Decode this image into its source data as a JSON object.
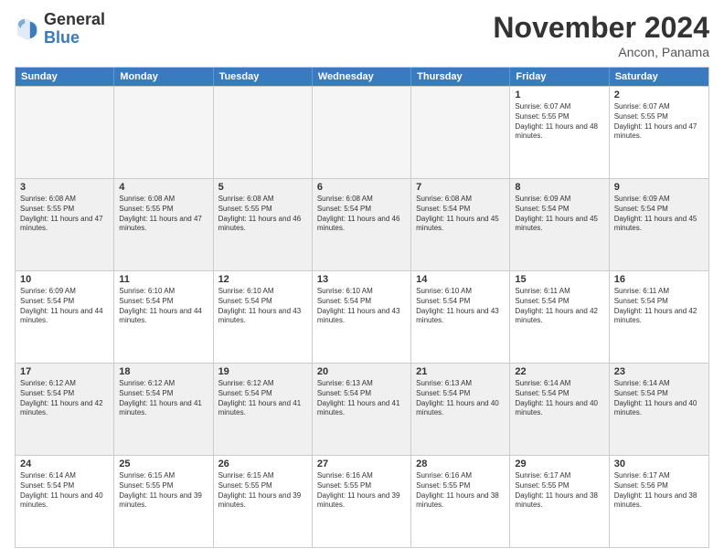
{
  "logo": {
    "general": "General",
    "blue": "Blue"
  },
  "header": {
    "month": "November 2024",
    "location": "Ancon, Panama"
  },
  "weekdays": [
    "Sunday",
    "Monday",
    "Tuesday",
    "Wednesday",
    "Thursday",
    "Friday",
    "Saturday"
  ],
  "rows": [
    [
      {
        "day": "",
        "text": "",
        "empty": true
      },
      {
        "day": "",
        "text": "",
        "empty": true
      },
      {
        "day": "",
        "text": "",
        "empty": true
      },
      {
        "day": "",
        "text": "",
        "empty": true
      },
      {
        "day": "",
        "text": "",
        "empty": true
      },
      {
        "day": "1",
        "text": "Sunrise: 6:07 AM\nSunset: 5:55 PM\nDaylight: 11 hours and 48 minutes.",
        "empty": false
      },
      {
        "day": "2",
        "text": "Sunrise: 6:07 AM\nSunset: 5:55 PM\nDaylight: 11 hours and 47 minutes.",
        "empty": false
      }
    ],
    [
      {
        "day": "3",
        "text": "Sunrise: 6:08 AM\nSunset: 5:55 PM\nDaylight: 11 hours and 47 minutes.",
        "empty": false
      },
      {
        "day": "4",
        "text": "Sunrise: 6:08 AM\nSunset: 5:55 PM\nDaylight: 11 hours and 47 minutes.",
        "empty": false
      },
      {
        "day": "5",
        "text": "Sunrise: 6:08 AM\nSunset: 5:55 PM\nDaylight: 11 hours and 46 minutes.",
        "empty": false
      },
      {
        "day": "6",
        "text": "Sunrise: 6:08 AM\nSunset: 5:54 PM\nDaylight: 11 hours and 46 minutes.",
        "empty": false
      },
      {
        "day": "7",
        "text": "Sunrise: 6:08 AM\nSunset: 5:54 PM\nDaylight: 11 hours and 45 minutes.",
        "empty": false
      },
      {
        "day": "8",
        "text": "Sunrise: 6:09 AM\nSunset: 5:54 PM\nDaylight: 11 hours and 45 minutes.",
        "empty": false
      },
      {
        "day": "9",
        "text": "Sunrise: 6:09 AM\nSunset: 5:54 PM\nDaylight: 11 hours and 45 minutes.",
        "empty": false
      }
    ],
    [
      {
        "day": "10",
        "text": "Sunrise: 6:09 AM\nSunset: 5:54 PM\nDaylight: 11 hours and 44 minutes.",
        "empty": false
      },
      {
        "day": "11",
        "text": "Sunrise: 6:10 AM\nSunset: 5:54 PM\nDaylight: 11 hours and 44 minutes.",
        "empty": false
      },
      {
        "day": "12",
        "text": "Sunrise: 6:10 AM\nSunset: 5:54 PM\nDaylight: 11 hours and 43 minutes.",
        "empty": false
      },
      {
        "day": "13",
        "text": "Sunrise: 6:10 AM\nSunset: 5:54 PM\nDaylight: 11 hours and 43 minutes.",
        "empty": false
      },
      {
        "day": "14",
        "text": "Sunrise: 6:10 AM\nSunset: 5:54 PM\nDaylight: 11 hours and 43 minutes.",
        "empty": false
      },
      {
        "day": "15",
        "text": "Sunrise: 6:11 AM\nSunset: 5:54 PM\nDaylight: 11 hours and 42 minutes.",
        "empty": false
      },
      {
        "day": "16",
        "text": "Sunrise: 6:11 AM\nSunset: 5:54 PM\nDaylight: 11 hours and 42 minutes.",
        "empty": false
      }
    ],
    [
      {
        "day": "17",
        "text": "Sunrise: 6:12 AM\nSunset: 5:54 PM\nDaylight: 11 hours and 42 minutes.",
        "empty": false
      },
      {
        "day": "18",
        "text": "Sunrise: 6:12 AM\nSunset: 5:54 PM\nDaylight: 11 hours and 41 minutes.",
        "empty": false
      },
      {
        "day": "19",
        "text": "Sunrise: 6:12 AM\nSunset: 5:54 PM\nDaylight: 11 hours and 41 minutes.",
        "empty": false
      },
      {
        "day": "20",
        "text": "Sunrise: 6:13 AM\nSunset: 5:54 PM\nDaylight: 11 hours and 41 minutes.",
        "empty": false
      },
      {
        "day": "21",
        "text": "Sunrise: 6:13 AM\nSunset: 5:54 PM\nDaylight: 11 hours and 40 minutes.",
        "empty": false
      },
      {
        "day": "22",
        "text": "Sunrise: 6:14 AM\nSunset: 5:54 PM\nDaylight: 11 hours and 40 minutes.",
        "empty": false
      },
      {
        "day": "23",
        "text": "Sunrise: 6:14 AM\nSunset: 5:54 PM\nDaylight: 11 hours and 40 minutes.",
        "empty": false
      }
    ],
    [
      {
        "day": "24",
        "text": "Sunrise: 6:14 AM\nSunset: 5:54 PM\nDaylight: 11 hours and 40 minutes.",
        "empty": false
      },
      {
        "day": "25",
        "text": "Sunrise: 6:15 AM\nSunset: 5:55 PM\nDaylight: 11 hours and 39 minutes.",
        "empty": false
      },
      {
        "day": "26",
        "text": "Sunrise: 6:15 AM\nSunset: 5:55 PM\nDaylight: 11 hours and 39 minutes.",
        "empty": false
      },
      {
        "day": "27",
        "text": "Sunrise: 6:16 AM\nSunset: 5:55 PM\nDaylight: 11 hours and 39 minutes.",
        "empty": false
      },
      {
        "day": "28",
        "text": "Sunrise: 6:16 AM\nSunset: 5:55 PM\nDaylight: 11 hours and 38 minutes.",
        "empty": false
      },
      {
        "day": "29",
        "text": "Sunrise: 6:17 AM\nSunset: 5:55 PM\nDaylight: 11 hours and 38 minutes.",
        "empty": false
      },
      {
        "day": "30",
        "text": "Sunrise: 6:17 AM\nSunset: 5:56 PM\nDaylight: 11 hours and 38 minutes.",
        "empty": false
      }
    ]
  ]
}
